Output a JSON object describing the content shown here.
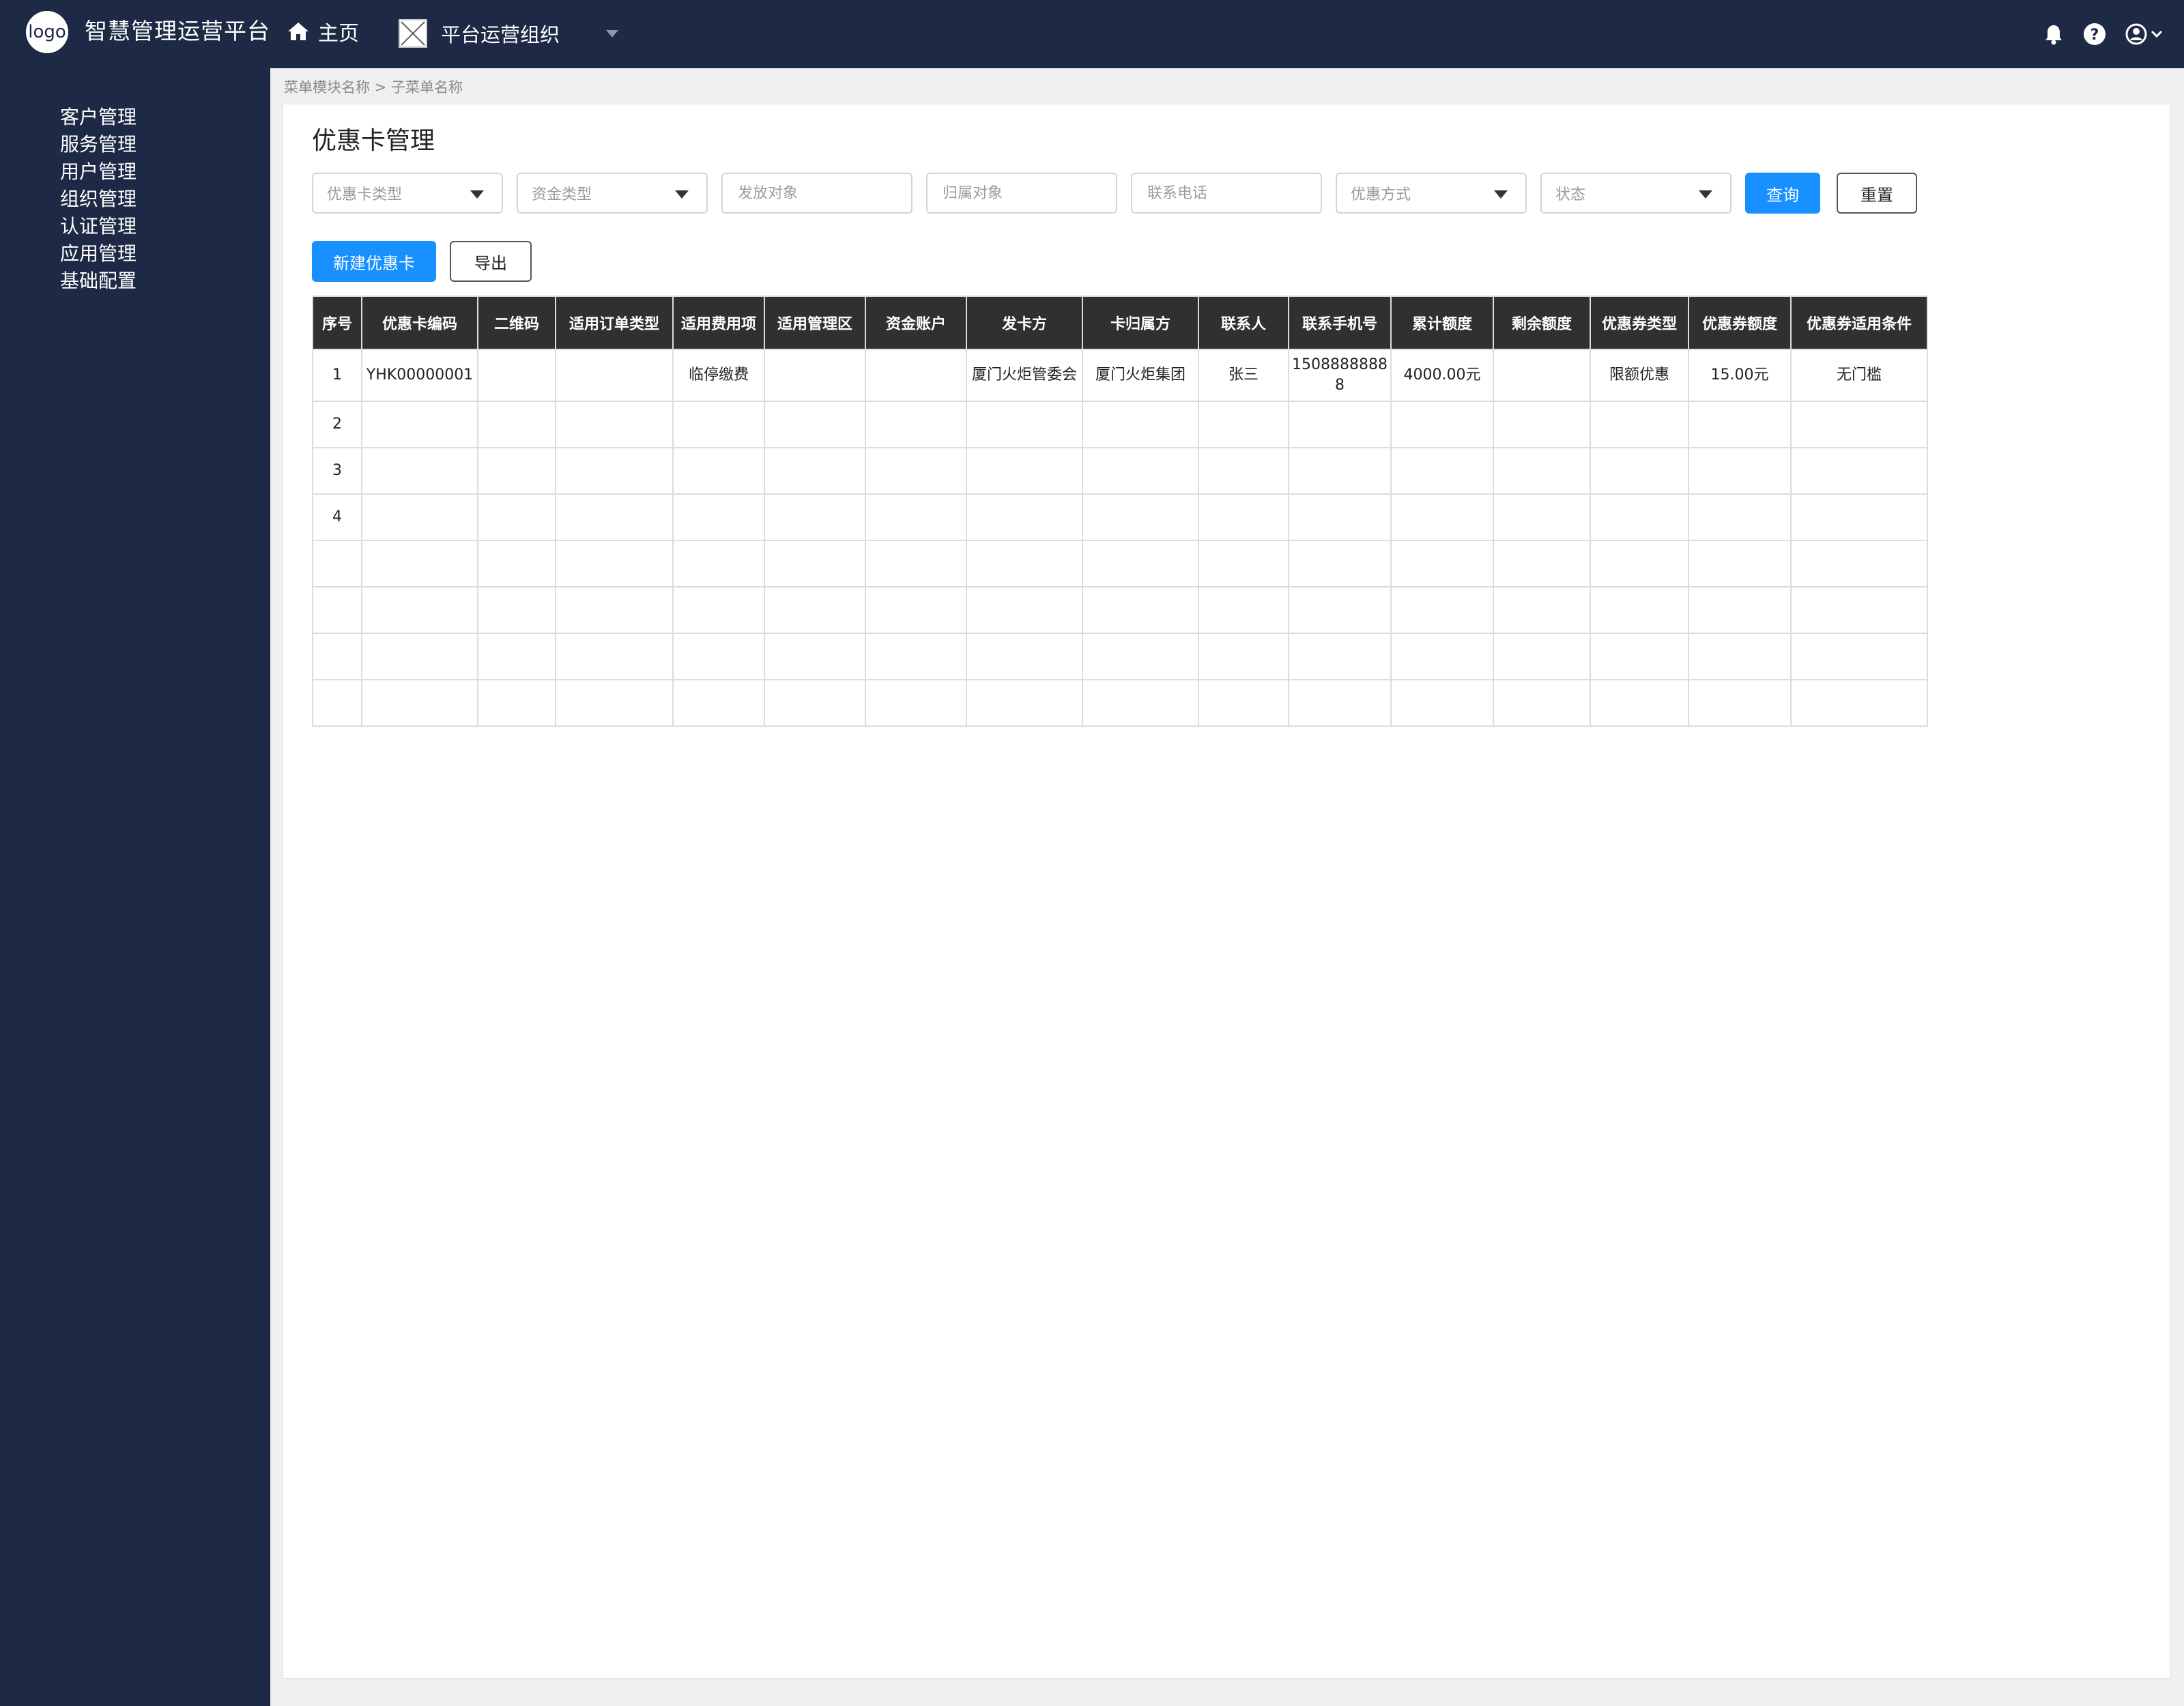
{
  "header": {
    "logo_text": "logo",
    "title": "智慧管理运营平台",
    "home_label": "主页",
    "org_name": "平台运营组织"
  },
  "sidebar": {
    "items": [
      {
        "label": "客户管理"
      },
      {
        "label": "服务管理"
      },
      {
        "label": "用户管理"
      },
      {
        "label": "组织管理"
      },
      {
        "label": "认证管理"
      },
      {
        "label": "应用管理"
      },
      {
        "label": "基础配置"
      }
    ]
  },
  "breadcrumb": "菜单模块名称 > 子菜单名称",
  "page": {
    "title": "优惠卡管理"
  },
  "filters": {
    "card_type": "优惠卡类型",
    "fund_type": "资金类型",
    "issue_target": "发放对象",
    "owner_target": "归属对象",
    "phone": "联系电话",
    "discount_mode": "优惠方式",
    "status": "状态",
    "query_label": "查询",
    "reset_label": "重置"
  },
  "actions": {
    "new_label": "新建优惠卡",
    "export_label": "导出"
  },
  "table": {
    "columns": [
      "序号",
      "优惠卡编码",
      "二维码",
      "适用订单类型",
      "适用费用项",
      "适用管理区",
      "资金账户",
      "发卡方",
      "卡归属方",
      "联系人",
      "联系手机号",
      "累计额度",
      "剩余额度",
      "优惠券类型",
      "优惠券额度",
      "优惠券适用条件"
    ],
    "rows": [
      [
        "1",
        "YHK00000001",
        "",
        "",
        "临停缴费",
        "",
        "",
        "厦门火炬管委会",
        "厦门火炬集团",
        "张三",
        "15088888888",
        "4000.00元",
        "",
        "限额优惠",
        "15.00元",
        "无门槛"
      ],
      [
        "2",
        "",
        "",
        "",
        "",
        "",
        "",
        "",
        "",
        "",
        "",
        "",
        "",
        "",
        "",
        ""
      ],
      [
        "3",
        "",
        "",
        "",
        "",
        "",
        "",
        "",
        "",
        "",
        "",
        "",
        "",
        "",
        "",
        ""
      ],
      [
        "4",
        "",
        "",
        "",
        "",
        "",
        "",
        "",
        "",
        "",
        "",
        "",
        "",
        "",
        "",
        ""
      ],
      [
        "",
        "",
        "",
        "",
        "",
        "",
        "",
        "",
        "",
        "",
        "",
        "",
        "",
        "",
        "",
        ""
      ],
      [
        "",
        "",
        "",
        "",
        "",
        "",
        "",
        "",
        "",
        "",
        "",
        "",
        "",
        "",
        "",
        ""
      ],
      [
        "",
        "",
        "",
        "",
        "",
        "",
        "",
        "",
        "",
        "",
        "",
        "",
        "",
        "",
        "",
        ""
      ],
      [
        "",
        "",
        "",
        "",
        "",
        "",
        "",
        "",
        "",
        "",
        "",
        "",
        "",
        "",
        "",
        ""
      ]
    ]
  },
  "colors": {
    "nav_bg": "#1d2945",
    "primary": "#1890ff",
    "table_header": "#303030"
  },
  "icons": [
    "home-icon",
    "image-placeholder-icon",
    "bell-icon",
    "help-icon",
    "user-icon",
    "chevron-down-icon"
  ]
}
